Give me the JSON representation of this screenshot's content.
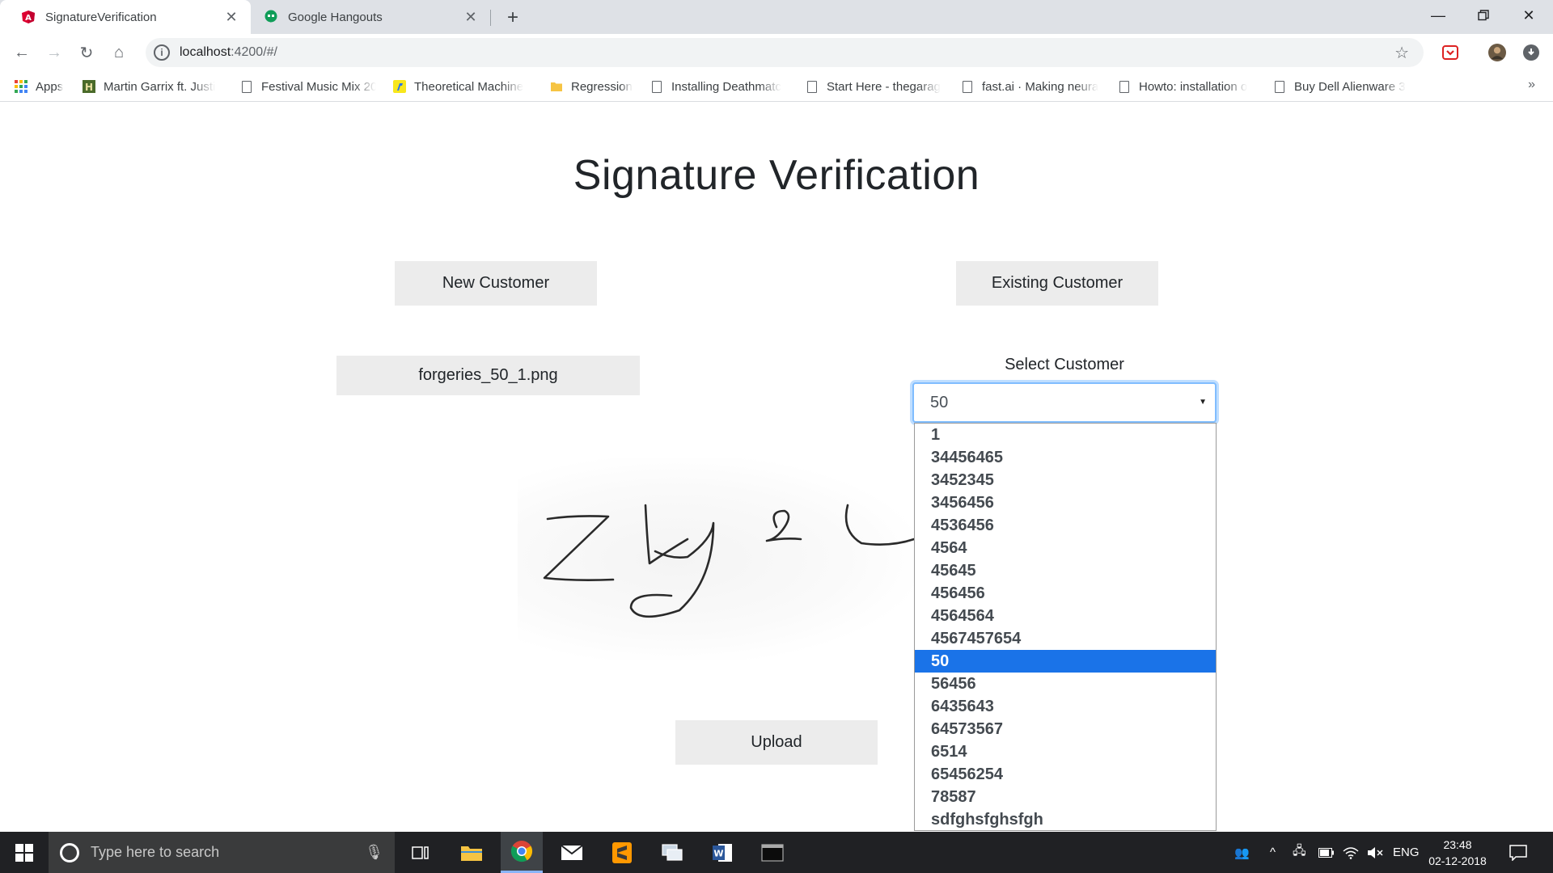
{
  "browser": {
    "tabs": [
      {
        "title": "SignatureVerification",
        "active": true,
        "icon": "angular-icon"
      },
      {
        "title": "Google Hangouts",
        "active": false,
        "icon": "hangouts-icon"
      }
    ],
    "url_host": "localhost",
    "url_rest": ":4200/#/",
    "bookmarks": [
      {
        "label": "Apps",
        "icon": "apps-grid-icon"
      },
      {
        "label": "Martin Garrix ft. Justi",
        "icon": "music-favicon"
      },
      {
        "label": "Festival Music Mix 20",
        "icon": "page-icon"
      },
      {
        "label": "Theoretical Machine",
        "icon": "flipkart-icon"
      },
      {
        "label": "Regression",
        "icon": "folder-icon"
      },
      {
        "label": "Installing Deathmatc",
        "icon": "page-icon"
      },
      {
        "label": "Start Here - thegarag",
        "icon": "page-icon"
      },
      {
        "label": "fast.ai · Making neura",
        "icon": "page-icon"
      },
      {
        "label": "Howto: installation o",
        "icon": "page-icon"
      },
      {
        "label": "Buy Dell Alienware 3",
        "icon": "page-icon"
      }
    ],
    "bookmarks_more": "»"
  },
  "page": {
    "title": "Signature Verification",
    "new_customer": "New Customer",
    "existing_customer": "Existing Customer",
    "file_name": "forgeries_50_1.png",
    "select_label": "Select Customer",
    "selected_value": "50",
    "options": [
      "1",
      "34456465",
      "3452345",
      "3456456",
      "4536456",
      "4564",
      "45645",
      "456456",
      "4564564",
      "4567457654",
      "50",
      "56456",
      "6435643",
      "64573567",
      "6514",
      "65456254",
      "78587",
      "sdfghsfghsfgh"
    ],
    "upload": "Upload"
  },
  "taskbar": {
    "search_placeholder": "Type here to search",
    "language": "ENG",
    "time": "23:48",
    "date": "02-12-2018"
  },
  "colors": {
    "accent": "#1a73e8",
    "button_bg": "#ececec",
    "focus_ring": "#80bdff",
    "taskbar": "#202124"
  }
}
